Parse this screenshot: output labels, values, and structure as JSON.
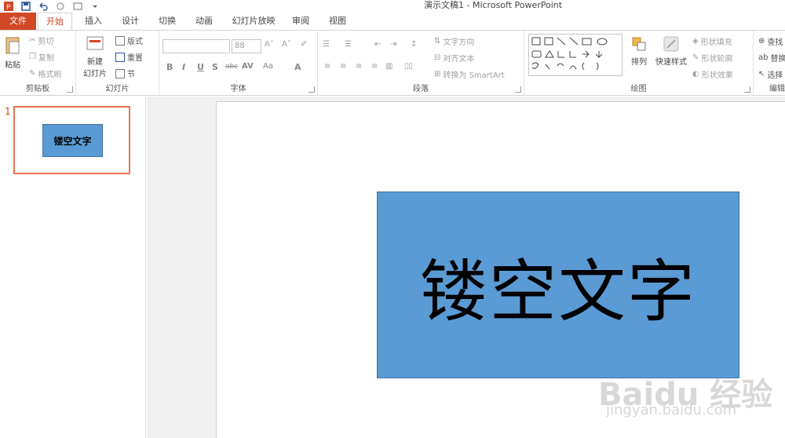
{
  "window": {
    "title": "演示文稿1 - Microsoft PowerPoint"
  },
  "tabs": [
    "文件",
    "开始",
    "插入",
    "设计",
    "切换",
    "动画",
    "幻灯片放映",
    "审阅",
    "视图"
  ],
  "ribbon": {
    "clipboard": {
      "paste": "粘贴",
      "cut": "剪切",
      "copy": "复制",
      "format_painter": "格式刷",
      "label": "剪贴板"
    },
    "slides": {
      "new_slide_line1": "新建",
      "new_slide_line2": "幻灯片",
      "layout": "版式",
      "reset": "重置",
      "section": "节",
      "label": "幻灯片"
    },
    "font": {
      "font_name": "",
      "font_size": "88",
      "label": "字体",
      "bold": "B",
      "italic": "I",
      "underline": "U",
      "shadow": "S",
      "strike": "abc",
      "spacing": "AV",
      "case": "Aa",
      "color": "A"
    },
    "paragraph": {
      "text_direction": "文字方向",
      "align_text": "对齐文本",
      "smartart": "转换为 SmartArt",
      "label": "段落"
    },
    "drawing": {
      "arrange": "排列",
      "quick_styles": "快速样式",
      "shape_fill": "形状填充",
      "shape_outline": "形状轮廓",
      "shape_effects": "形状效果",
      "label": "绘图"
    },
    "editing": {
      "find": "查找",
      "replace": "替换",
      "select": "选择",
      "label": "编辑"
    }
  },
  "thumbnails": [
    {
      "number": "1",
      "text": "镂空文字"
    }
  ],
  "slide": {
    "text": "镂空文字"
  },
  "watermark": {
    "logo": "Baidu 经验",
    "url": "jingyan.baidu.com"
  },
  "colors": {
    "accent": "#d24726",
    "shape_fill": "#5b9bd5",
    "shape_border": "#41719c",
    "thumb_border": "#e9734f"
  }
}
